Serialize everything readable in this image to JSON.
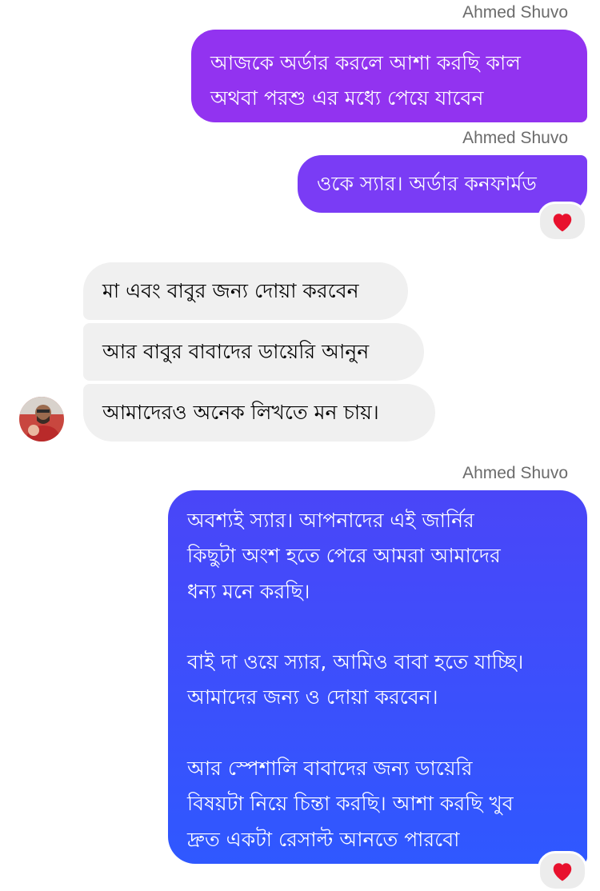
{
  "conversation": {
    "messages": [
      {
        "sender": "Ahmed Shuvo",
        "direction": "outgoing",
        "text": "আজকে অর্ডার করলে আশা করছি কাল\nঅথবা পরশু এর মধ্যে পেয়ে যাবেন"
      },
      {
        "sender": "Ahmed Shuvo",
        "direction": "outgoing",
        "text": "ওকে স্যার। অর্ডার কনফার্মড",
        "reaction": "heart-icon"
      },
      {
        "direction": "incoming",
        "text": "মা এবং বাবুর জন্য দোয়া করবেন"
      },
      {
        "direction": "incoming",
        "text": "আর বাবুর বাবাদের ডায়েরি আনুন"
      },
      {
        "direction": "incoming",
        "text": "আমাদেরও অনেক লিখতে মন চায়।"
      },
      {
        "sender": "Ahmed Shuvo",
        "direction": "outgoing",
        "text": "অবশ্যই স্যার। আপনাদের এই জার্নির\nকিছুটা অংশ হতে পেরে আমরা আমাদের\nধন্য মনে করছি।\n\nবাই দা ওয়ে স্যার, আমিও বাবা হতে যাচ্ছি।\nআমাদের জন্য ও দোয়া করবেন।\n\nআর স্পেশালি বাবাদের জন্য ডায়েরি\nবিষয়টা নিয়ে চিন্তা করছি। আশা করছি খুব\nদ্রুত একটা রেসাল্ট আনতে পারবো",
        "reaction": "heart-icon"
      }
    ]
  },
  "colors": {
    "outgoing_purple": "#9233f0",
    "outgoing_violet": "#7a3cf5",
    "outgoing_blue": "#3651fb",
    "incoming_gray": "#f0f0f0",
    "heart": "#e8112d"
  }
}
